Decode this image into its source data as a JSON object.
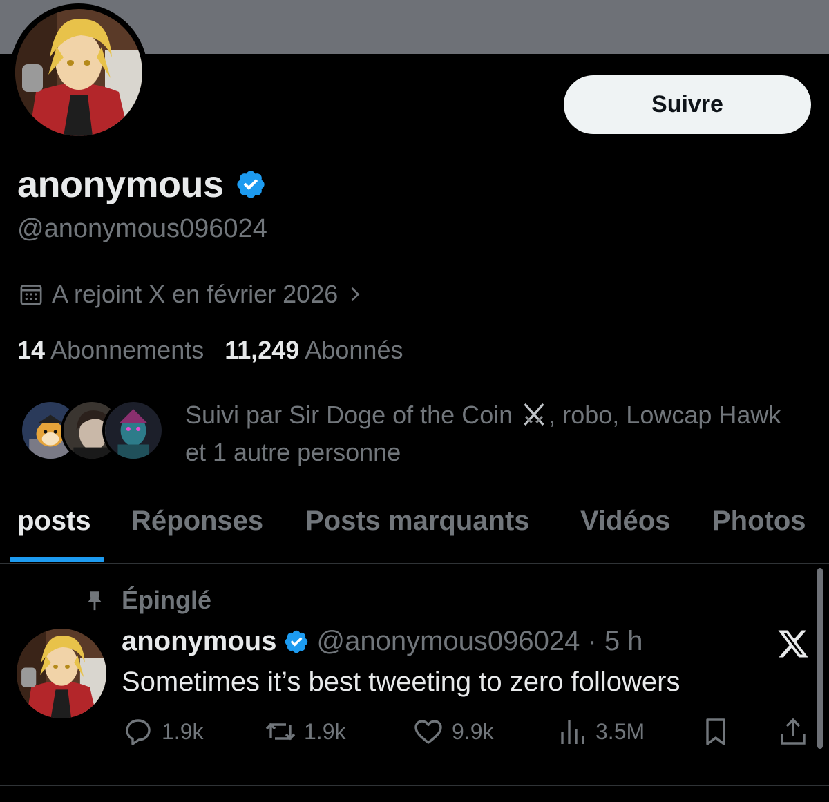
{
  "profile": {
    "follow_label": "Suivre",
    "display_name": "anonymous",
    "handle": "@anonymous096024",
    "joined": "A rejoint X en février 2026",
    "following_count": "14",
    "following_label": "Abonnements",
    "followers_count": "11,249",
    "followers_label": "Abonnés",
    "followed_by_prefix": "Suivi par Sir Doge of the Coin ",
    "followed_by_suffix": ", robo, Lowcap Hawk et 1 autre personne"
  },
  "tabs": [
    {
      "label": "posts"
    },
    {
      "label": "Réponses"
    },
    {
      "label": "Posts marquants"
    },
    {
      "label": "Vidéos"
    },
    {
      "label": "Photos"
    }
  ],
  "post": {
    "pinned_label": "Épinglé",
    "author": "anonymous",
    "meta": "@anonymous096024 · 5 h",
    "text": "Sometimes it’s best tweeting to zero followers",
    "replies": "1.9k",
    "reposts": "1.9k",
    "likes": "9.9k",
    "views": "3.5M"
  },
  "colors": {
    "accent": "#1d9bf0",
    "verified": "#1d9bf0",
    "muted_text": "#71767b",
    "primary_text": "#e7e9ea",
    "background": "#000000"
  },
  "icons": [
    "verified-badge-icon",
    "calendar-icon",
    "chevron-right-icon",
    "crossed-swords-icon",
    "pin-icon",
    "x-logo-icon",
    "reply-icon",
    "repost-icon",
    "like-icon",
    "views-icon",
    "bookmark-icon",
    "share-icon"
  ]
}
